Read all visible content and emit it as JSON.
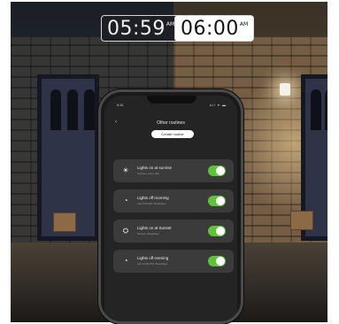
{
  "clocks": {
    "night": {
      "time": "05:59",
      "ampm": "AM"
    },
    "day": {
      "time": "06:00",
      "ampm": "AM"
    }
  },
  "phone": {
    "status_time": "9:41",
    "status_icons": "all ▾ ▬",
    "back_icon": "chevron-left-icon",
    "header_title": "Other routines",
    "header_button": "Create routine",
    "routines": [
      {
        "title": "Lights on at sunrise",
        "subtitle": "Sunrise, every day",
        "icon": "sunrise-icon",
        "enabled": true
      },
      {
        "title": "Lights off morning",
        "subtitle": "Lab 9:00 AM, Weekdays",
        "icon": "clock-icon",
        "enabled": true
      },
      {
        "title": "Lights on at Sunset",
        "subtitle": "Sunset, Weekdays",
        "icon": "sunset-icon",
        "enabled": true
      },
      {
        "title": "Lights off evening",
        "subtitle": "Lab 11:00 PM, Weekdays",
        "icon": "clock-icon",
        "enabled": true
      }
    ],
    "toggle_color": "#5fc23a"
  }
}
